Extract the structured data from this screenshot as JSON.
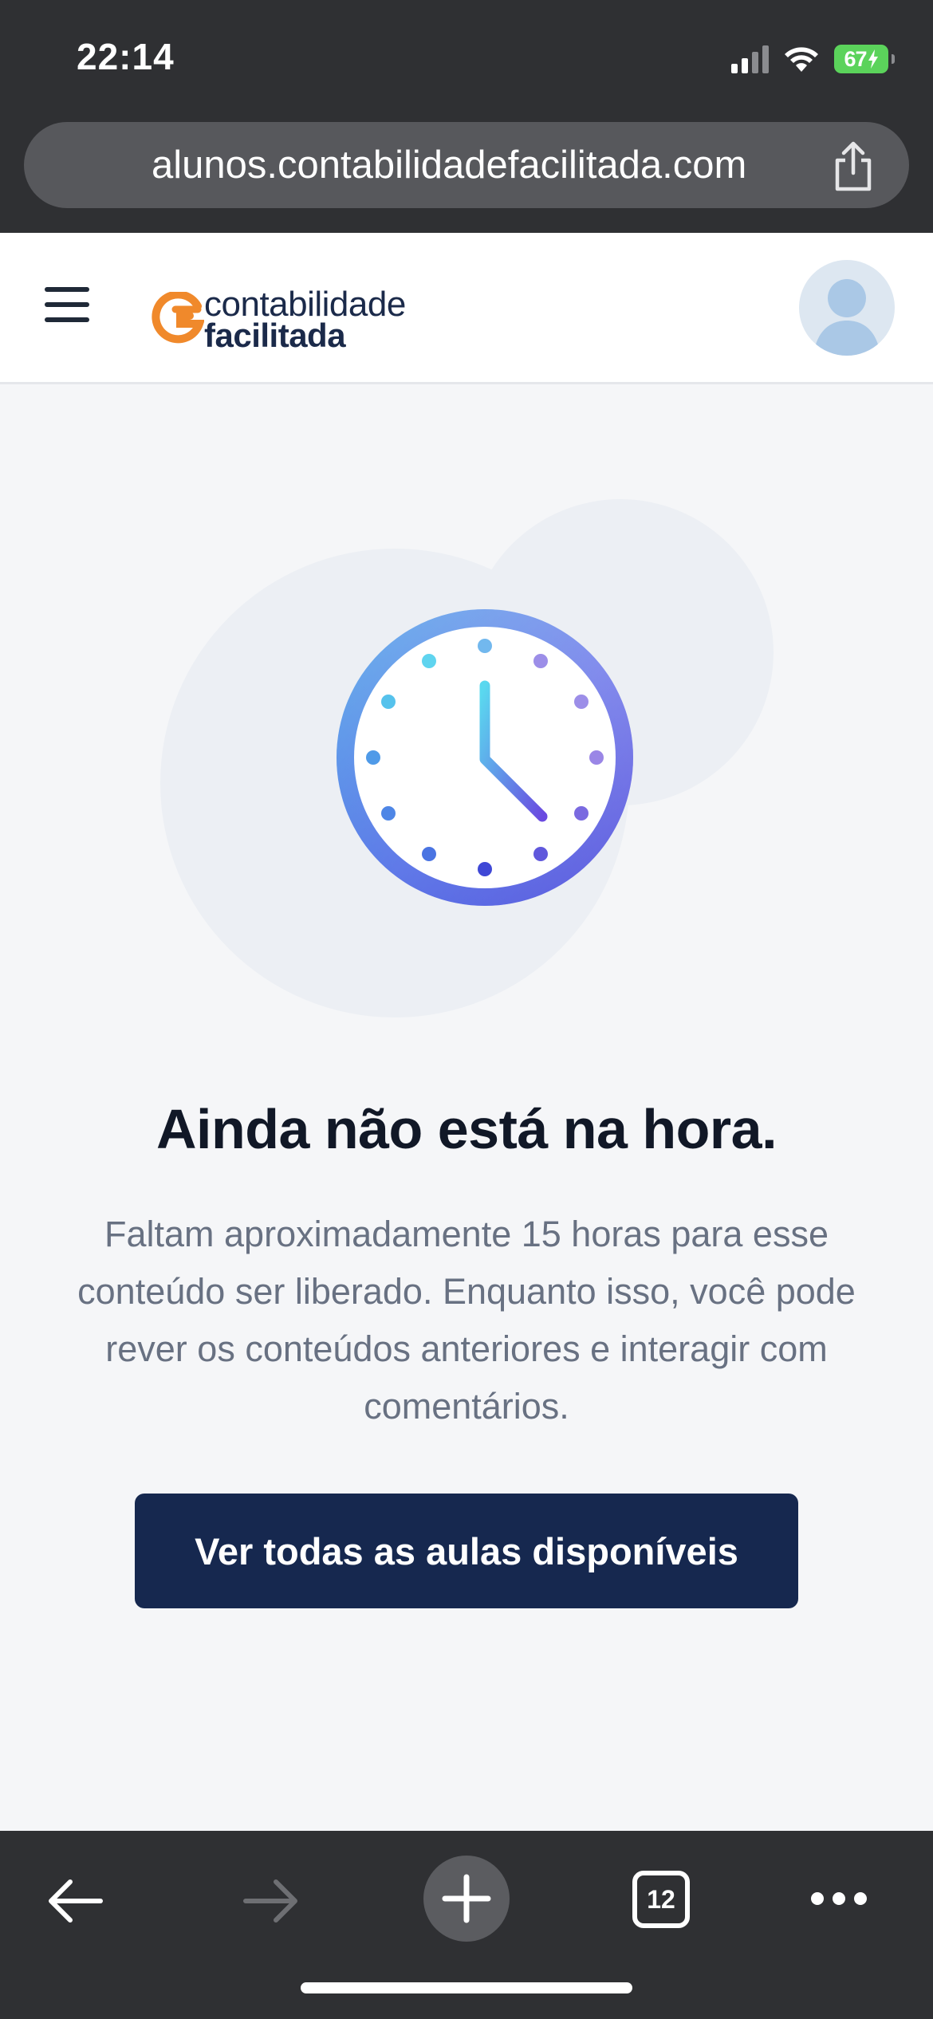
{
  "status_bar": {
    "time": "22:14",
    "battery": "67"
  },
  "browser": {
    "url": "alunos.contabilidadefacilitada.com",
    "tab_count": "12"
  },
  "header": {
    "logo_line1": "contabilidade",
    "logo_line2": "facilitada"
  },
  "main": {
    "title": "Ainda não está na hora.",
    "description": "Faltam aproximadamente 15 horas para esse conteúdo ser liberado. Enquanto isso, você pode rever os conteúdos anteriores e interagir com comentários.",
    "cta_label": "Ver todas as aulas disponíveis"
  },
  "colors": {
    "brand_navy": "#16284f",
    "brand_orange": "#f0892b",
    "browser_chrome": "#2f3033",
    "page_bg": "#f5f6f8"
  },
  "icons": [
    "menu-icon",
    "share-icon",
    "avatar-icon",
    "clock-icon",
    "back-arrow-icon",
    "forward-arrow-icon",
    "plus-icon",
    "tabs-icon",
    "more-icon"
  ]
}
